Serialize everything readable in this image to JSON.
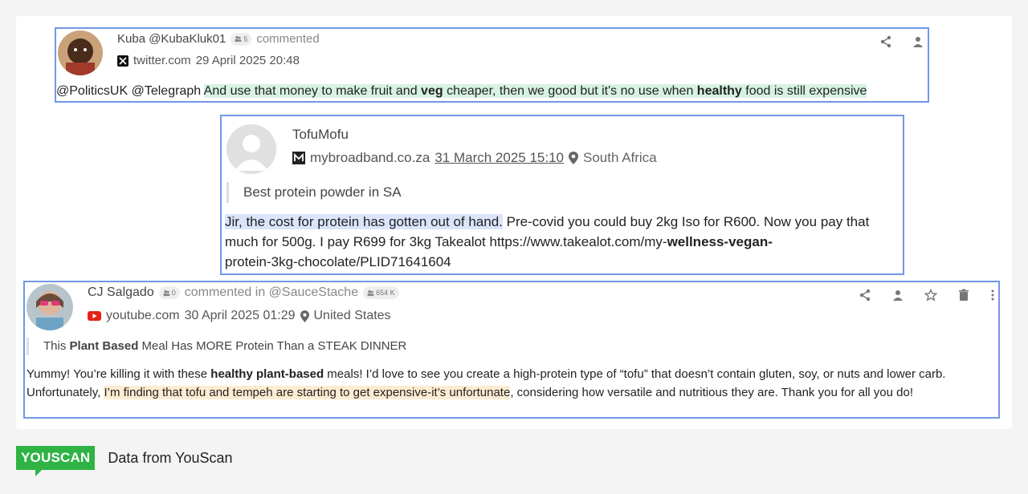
{
  "posts": [
    {
      "author": "Kuba @KubaKluk01",
      "badge": "5",
      "action": "commented",
      "source": "twitter.com",
      "date": "29 April 2025 20:48",
      "body": {
        "plain": "@PoliticsUK @Telegraph ",
        "hl_a": "And use that money to make fruit and ",
        "hl_b": "veg",
        "hl_c": " cheaper, then we good but it's no use when ",
        "hl_d": "healthy",
        "hl_e": " food is still expensive"
      },
      "highlight_color": "#d7f2e3"
    },
    {
      "author": "TofuMofu",
      "source": "mybroadband.co.za",
      "date": "31 March 2025 15:10",
      "location": "South Africa",
      "quote": "Best protein powder in SA",
      "body": {
        "hl": "Jir, the cost for protein has gotten out of hand.",
        "a": " Pre-covid you could buy 2kg Iso for R600. Now you pay that much for 500g. I pay R699 for 3kg Takealot https://www.takealot.com/my-",
        "b": "wellness-vegan-",
        "c": "protein-3kg-chocolate/PLID71641604"
      },
      "highlight_color": "#dbe4fb"
    },
    {
      "author": "CJ Salgado",
      "badge": "0",
      "action": "commented in @SauceStache",
      "channel_badge": "654 K",
      "source": "youtube.com",
      "date": "30 April 2025 01:29",
      "location": "United States",
      "quote": {
        "a": "This ",
        "b": "Plant Based",
        "c": " Meal Has MORE Protein Than a STEAK DINNER"
      },
      "body": {
        "a": "Yummy! You’re killing it with these ",
        "b": "healthy plant-based",
        "c": " meals! I’d love to see you create a high-protein type of “tofu” that doesn’t contain gluten, soy, or nuts and lower carb. Unfortunately, ",
        "hl": "I’m finding that tofu and tempeh are starting to get expensive-it’s unfortunate",
        "d": ", considering how versatile and nutritious they are. Thank you for all you do!"
      },
      "highlight_color": "#fdecd2"
    }
  ],
  "footer": {
    "logo": "YOUSCAN",
    "text": "Data from YouScan"
  },
  "colors": {
    "card_border": "#6f98e8",
    "logo_green": "#2fb344",
    "youtube_red": "#e62117"
  },
  "icons": [
    "share-icon",
    "person-icon",
    "star-icon",
    "trash-icon",
    "more-icon",
    "x-logo-icon",
    "mybroadband-icon",
    "youtube-icon",
    "location-pin-icon",
    "followers-icon"
  ]
}
